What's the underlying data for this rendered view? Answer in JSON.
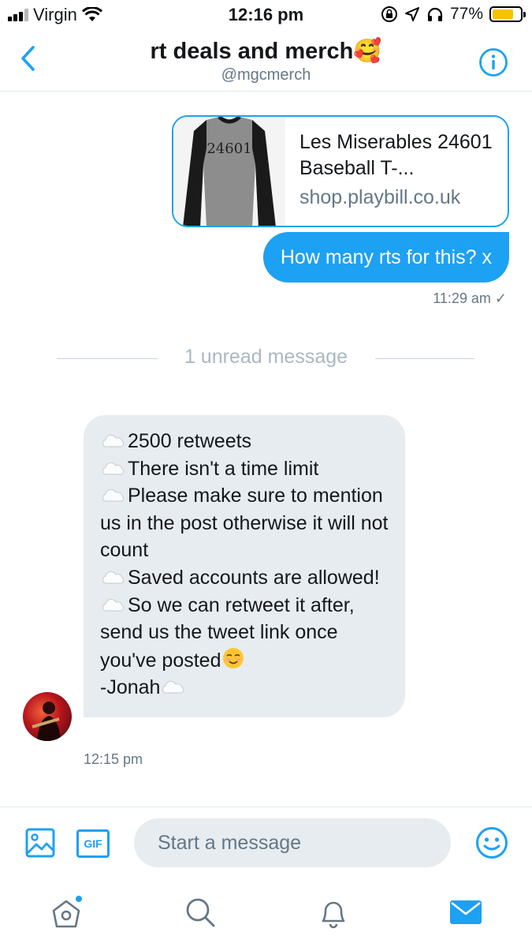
{
  "status_bar": {
    "carrier": "Virgin",
    "time": "12:16 pm",
    "battery": "77%",
    "battery_level": 0.77,
    "battery_color": "#f5c400"
  },
  "header": {
    "title": "rt deals and merch🥰",
    "handle": "@mgcmerch",
    "back_icon": "chevron-left-icon",
    "info_icon": "info-icon"
  },
  "link_card": {
    "title": "Les Miserables 24601 Baseball T-...",
    "domain": "shop.playbill.co.uk",
    "shirt_text": "24601"
  },
  "outgoing": {
    "text": "How many rts for this? x",
    "time": "11:29 am ✓"
  },
  "divider": {
    "text": "1 unread message"
  },
  "incoming": {
    "lines": [
      "2500 retweets",
      "There isn't a time limit",
      "Please make sure to mention us in the post otherwise it will not count",
      "Saved accounts are allowed!",
      "So we can retweet it after, send us the tweet link once you've posted",
      "-Jonah"
    ],
    "time": "12:15 pm"
  },
  "composer": {
    "placeholder": "Start a message",
    "gif_label": "GIF"
  },
  "colors": {
    "accent": "#1da1f2",
    "bubble_in": "#e6ecf0",
    "muted": "#657786"
  }
}
